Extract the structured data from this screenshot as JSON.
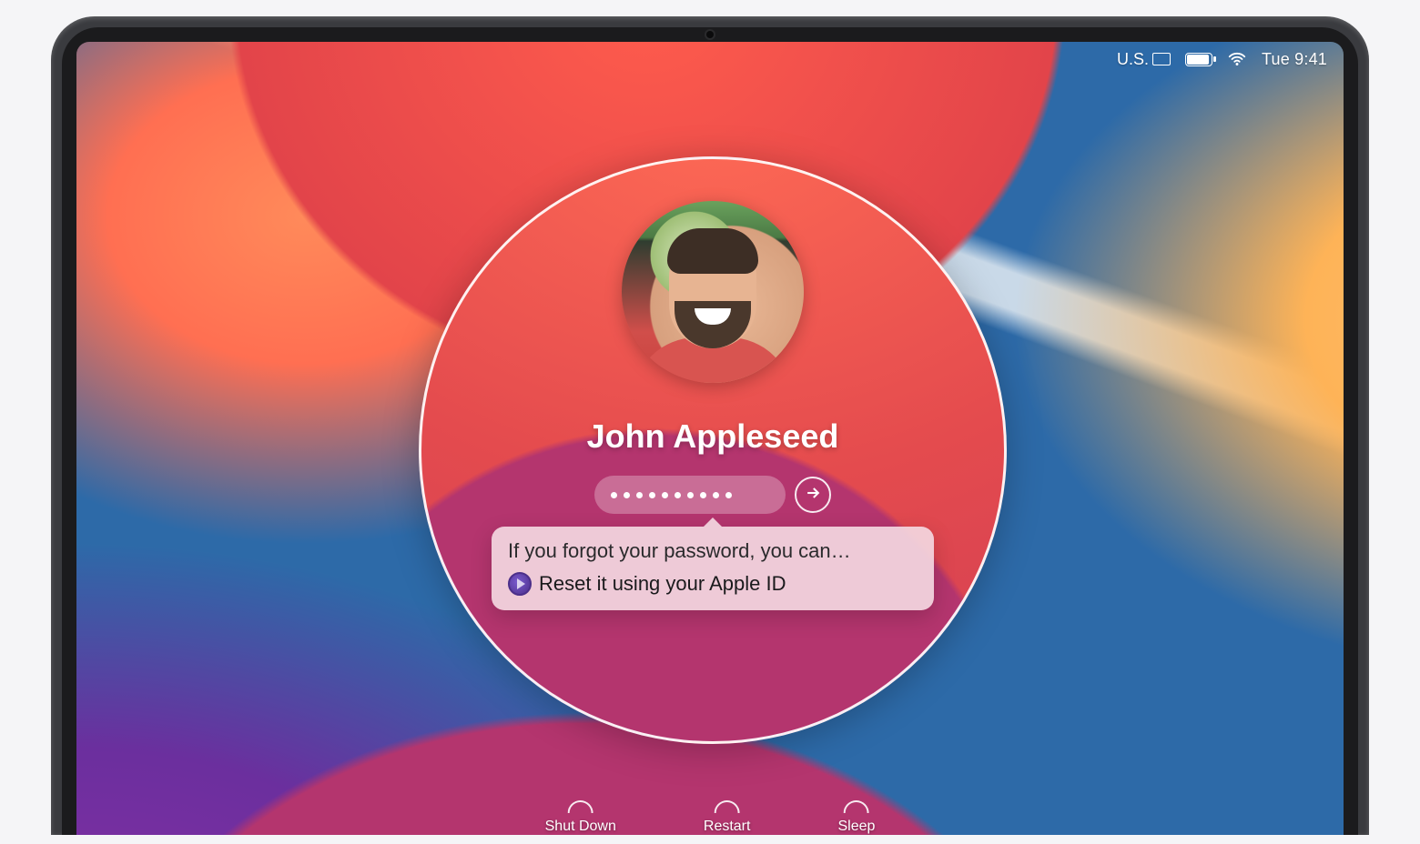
{
  "menubar": {
    "input_source": "U.S.",
    "time": "Tue 9:41"
  },
  "login": {
    "username": "John Appleseed",
    "password_dot_count": 10,
    "hint_title": "If you forgot your password, you can…",
    "hint_action": "Reset it using your Apple ID"
  },
  "power": {
    "shutdown": "Shut Down",
    "restart": "Restart",
    "sleep": "Sleep"
  }
}
